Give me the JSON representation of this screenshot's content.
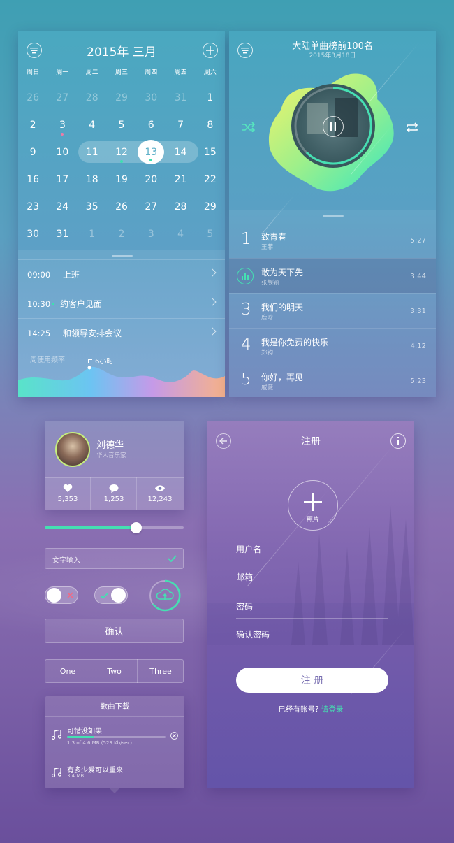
{
  "calendar": {
    "title": "2015年 三月",
    "weekdays": [
      "周日",
      "周一",
      "周二",
      "周三",
      "周四",
      "周五",
      "周六"
    ],
    "weeks": [
      [
        "26",
        "27",
        "28",
        "29",
        "30",
        "31",
        "1"
      ],
      [
        "2",
        "3",
        "4",
        "5",
        "6",
        "7",
        "8"
      ],
      [
        "9",
        "10",
        "11",
        "12",
        "13",
        "14",
        "15"
      ],
      [
        "16",
        "17",
        "18",
        "19",
        "20",
        "21",
        "22"
      ],
      [
        "23",
        "24",
        "35",
        "26",
        "27",
        "28",
        "29"
      ],
      [
        "30",
        "31",
        "1",
        "2",
        "3",
        "4",
        "5"
      ]
    ],
    "events": [
      {
        "time": "09:00",
        "title": "上班"
      },
      {
        "time": "10:30",
        "title": "约客户见面"
      },
      {
        "time": "14:25",
        "title": "和领导安排会议"
      }
    ],
    "usage_label": "周使用频率",
    "usage_value": "6小时",
    "colors": {
      "dot_pink": "#f07aa6",
      "dot_green": "#3de0b0"
    }
  },
  "music": {
    "title": "大陆单曲榜前100名",
    "date": "2015年3月18日",
    "songs": [
      {
        "rank": "1",
        "name": "致青春",
        "artist": "王菲",
        "duration": "5:27"
      },
      {
        "rank": "",
        "name": "敢为天下先",
        "artist": "张靓颖",
        "duration": "3:44"
      },
      {
        "rank": "3",
        "name": "我们的明天",
        "artist": "鹿晗",
        "duration": "3:31"
      },
      {
        "rank": "4",
        "name": "我是你免费的快乐",
        "artist": "郑钧",
        "duration": "4:12"
      },
      {
        "rank": "5",
        "name": "你好，再见",
        "artist": "戚薇",
        "duration": "5:23"
      }
    ]
  },
  "profile": {
    "name": "刘德华",
    "subtitle": "华人音乐家",
    "stats": [
      {
        "icon": "heart-icon",
        "value": "5,353"
      },
      {
        "icon": "comment-icon",
        "value": "1,253"
      },
      {
        "icon": "eye-icon",
        "value": "12,243"
      }
    ]
  },
  "controls": {
    "slider_level": 0.66,
    "text_input_value": "文字输入",
    "confirm_label": "确认",
    "segments": [
      "One",
      "Two",
      "Three"
    ],
    "accent": "#45e0b2"
  },
  "download": {
    "title": "歌曲下载",
    "items": [
      {
        "name": "可惜没如果",
        "detail": "1.3 of 4.6 MB (523 Kb/sec)",
        "progress": 0.28
      },
      {
        "name": "有多少爱可以重来",
        "detail": "3.4 MB"
      }
    ]
  },
  "register": {
    "title": "注册",
    "photo_label": "照片",
    "fields": [
      "用户名",
      "邮箱",
      "密码",
      "确认密码"
    ],
    "submit_label": "注 册",
    "login_prompt": "已经有账号?",
    "login_link": "请登录"
  }
}
